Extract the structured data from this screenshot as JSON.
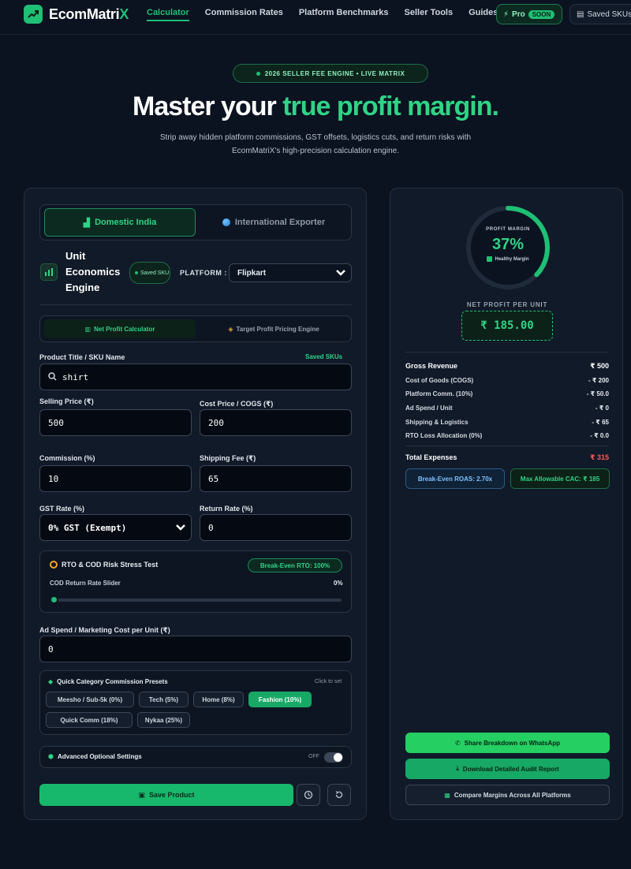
{
  "nav": {
    "brand_first": "Ecom",
    "brand_mid": "Matri",
    "brand_last": "X",
    "links": [
      "Calculator",
      "Commission Rates",
      "Platform Benchmarks",
      "Seller Tools",
      "Guides"
    ],
    "pro_label": "Pro",
    "pro_badge": "SOON",
    "saved_label": "Saved SKUs"
  },
  "hero": {
    "tag": "2026 SELLER FEE ENGINE • LIVE MATRIX",
    "title_a": "Master your ",
    "title_b": "true profit margin.",
    "subtitle": "Strip away hidden platform commissions, GST offsets, logistics cuts, and return risks with EcomMatriX's high-precision calculation engine."
  },
  "calculator": {
    "mode_domestic": "Domestic India",
    "mode_export": "International Exporter",
    "engine_title": "Unit Economics Engine",
    "saved_sku": "Saved SKU",
    "platform_label": "PLATFORM :",
    "platform_value": "Flipkart",
    "calc_net": "Net Profit Calculator",
    "calc_target": "Target Profit Pricing Engine",
    "product_label": "Product Title / SKU Name",
    "saved_skus_link": "Saved SKUs",
    "product_value": "shirt",
    "selling_label": "Selling Price (₹)",
    "selling_value": "500",
    "cost_label": "Cost Price / COGS (₹)",
    "cost_value": "200",
    "commission_label": "Commission (%)",
    "commission_value": "10",
    "shipping_label": "Shipping Fee (₹)",
    "shipping_value": "65",
    "gst_label": "GST Rate (%)",
    "gst_value": "0% GST (Exempt)",
    "return_label": "Return Rate (%)",
    "return_value": "0",
    "rto_title": "RTO & COD Risk Stress Test",
    "rto_badge": "Break-Even RTO: 100%",
    "rto_slider_label": "COD Return Rate Slider",
    "rto_slider_value": "0%",
    "rto_level": 0,
    "adspend_label": "Ad Spend / Marketing Cost per Unit (₹)",
    "adspend_value": "0",
    "preset_title": "Quick Category Commission Presets",
    "preset_hint": "Click to set",
    "presets": [
      "Meesho / Sub-5k (0%)",
      "Tech (5%)",
      "Home (8%)",
      "Fashion (10%)",
      "Quick Comm (18%)",
      "Nykaa (25%)"
    ],
    "adv_label": "Advanced Optional Settings",
    "adv_state": "OFF",
    "save_label": "Save Product"
  },
  "results": {
    "gauge_label": "PROFIT MARGIN",
    "gauge_value": "37%",
    "gauge_fraction": 0.37,
    "health": "Healthy Margin",
    "np_label": "NET PROFIT PER UNIT",
    "np_value": "₹ 185.00",
    "rows": [
      {
        "label": "Gross Revenue",
        "value": "₹ 500"
      },
      {
        "label": "Cost of Goods (COGS)",
        "value": "- ₹ 200"
      },
      {
        "label": "Platform Comm. (10%)",
        "value": "- ₹ 50.0"
      },
      {
        "label": "Ad Spend / Unit",
        "value": "- ₹ 0"
      },
      {
        "label": "Shipping & Logistics",
        "value": "- ₹ 65"
      },
      {
        "label": "RTO Loss Allocation (0%)",
        "value": "- ₹ 0.0"
      }
    ],
    "total_label": "Total Expenses",
    "total_value": "₹ 315",
    "roas": "Break-Even ROAS: 2.70x",
    "cac": "Max Allowable CAC: ₹ 185",
    "wa_btn": "Share Breakdown on WhatsApp",
    "dl_btn": "Download Detailed Audit Report",
    "cmp_btn": "Compare Margins Across All Platforms"
  }
}
